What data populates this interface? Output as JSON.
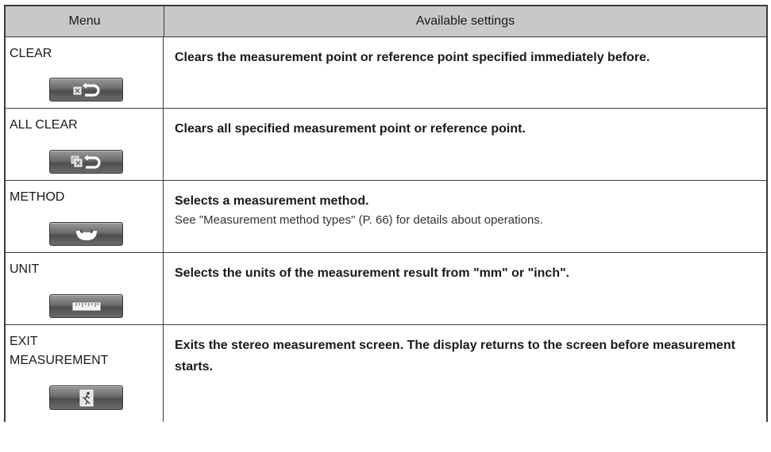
{
  "header": {
    "menu": "Menu",
    "settings": "Available settings"
  },
  "rows": [
    {
      "menu": "CLEAR",
      "icon": "clear-icon",
      "desc": "Clears the measurement point or reference point specified immediately before.",
      "note": ""
    },
    {
      "menu": "ALL CLEAR",
      "icon": "all-clear-icon",
      "desc": "Clears all specified measurement point or reference point.",
      "note": ""
    },
    {
      "menu": "METHOD",
      "icon": "method-icon",
      "desc": "Selects a measurement method.",
      "note": "See \"Measurement method types\" (P. 66) for details about operations."
    },
    {
      "menu": "UNIT",
      "icon": "ruler-icon",
      "desc": "Selects the units of the measurement result from \"mm\" or \"inch\".",
      "note": ""
    },
    {
      "menu_line1": "EXIT",
      "menu_line2": "MEASUREMENT",
      "icon": "exit-icon",
      "desc": "Exits the stereo measurement screen. The display returns to the screen before measurement starts.",
      "note": ""
    }
  ]
}
